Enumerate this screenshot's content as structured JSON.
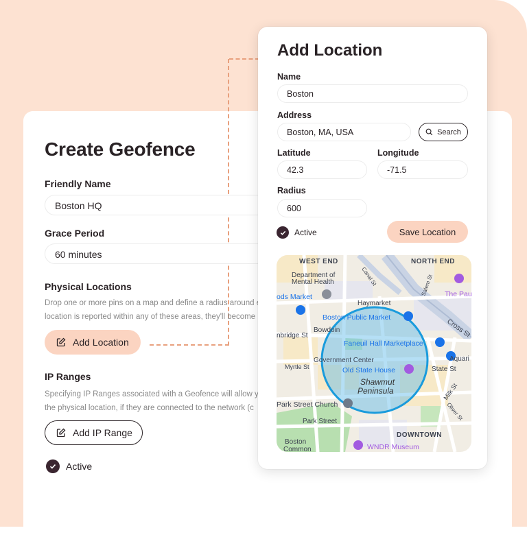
{
  "geofence": {
    "title": "Create Geofence",
    "friendly_name_label": "Friendly Name",
    "friendly_name_value": "Boston HQ",
    "grace_period_label": "Grace Period",
    "grace_period_value": "60 minutes",
    "physical_locations_label": "Physical Locations",
    "physical_locations_help": [
      "Drop one or more pins on a map and define a radius around e",
      "location is reported within any of these areas, they'll become"
    ],
    "add_location_label": "Add Location",
    "ip_ranges_label": "IP Ranges",
    "ip_ranges_help": [
      "Specifying IP Ranges associated with a Geofence will allow y",
      "the physical location, if they are connected to the network (c"
    ],
    "add_ip_range_label": "Add IP Range",
    "active_label": "Active",
    "active_checked": true
  },
  "modal": {
    "title": "Add Location",
    "name_label": "Name",
    "name_value": "Boston",
    "address_label": "Address",
    "address_value": "Boston, MA, USA",
    "search_label": "Search",
    "latitude_label": "Latitude",
    "latitude_value": "42.3",
    "longitude_label": "Longitude",
    "longitude_value": "-71.5",
    "radius_label": "Radius",
    "radius_value": "600",
    "active_label": "Active",
    "active_checked": true,
    "save_label": "Save Location"
  },
  "map": {
    "labels": {
      "west_end": "WEST END",
      "north_end": "NORTH END",
      "dept_mental_1": "Department of",
      "dept_mental_2": "Mental Health",
      "market": "ods Market",
      "the_pau": "The Pau",
      "haymarket": "Haymarket",
      "boston_public_market": "Boston Public Market",
      "bowdoin": "Bowdoin",
      "bridge_st": "nbridge St",
      "faneuil": "Faneuil Hall Marketplace",
      "government_center": "Government Center",
      "old_state_house": "Old State House",
      "shawmut_1": "Shawmut",
      "shawmut_2": "Peninsula",
      "myrtle": "Myrtle St",
      "state_st": "State St",
      "park_street_church": "Park Street Church",
      "park_street": "Park Street",
      "downtown": "DOWNTOWN",
      "boston_common_1": "Boston",
      "boston_common_2": "Common",
      "wndr": "WNDR Museum",
      "canal_st": "Canal St",
      "salem_st": "Salem St",
      "cross_st": "Cross St",
      "milk_st": "Milk St",
      "oliver_st": "Oliver St",
      "aquari": "Aquari"
    },
    "colors": {
      "radius_fill": "#5ab7e8",
      "radius_stroke": "#1a9bdc",
      "poi_blue": "#1a73e8",
      "poi_purple": "#a25be0"
    }
  },
  "colors": {
    "background": "#fde2d2",
    "accent_button": "#fbd4c1",
    "dashed_connector": "#e8a07e",
    "check": "#3a2530"
  }
}
